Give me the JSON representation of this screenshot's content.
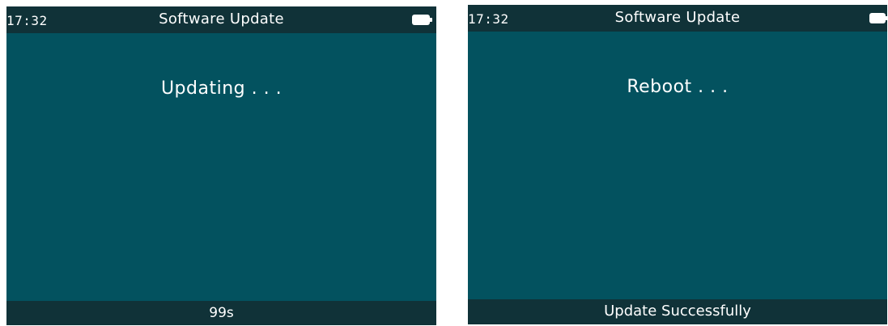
{
  "screens": [
    {
      "clock": "17:32",
      "title": "Software Update",
      "battery_icon": "battery-full-icon",
      "message": "Updating . . .",
      "footer": "99s"
    },
    {
      "clock": "17:32",
      "title": "Software Update",
      "battery_icon": "battery-full-icon",
      "message": "Reboot . . .",
      "footer": "Update  Successfully"
    }
  ],
  "colors": {
    "screen_background": "#03525f",
    "bar_background": "#103238",
    "text": "#ffffff"
  }
}
